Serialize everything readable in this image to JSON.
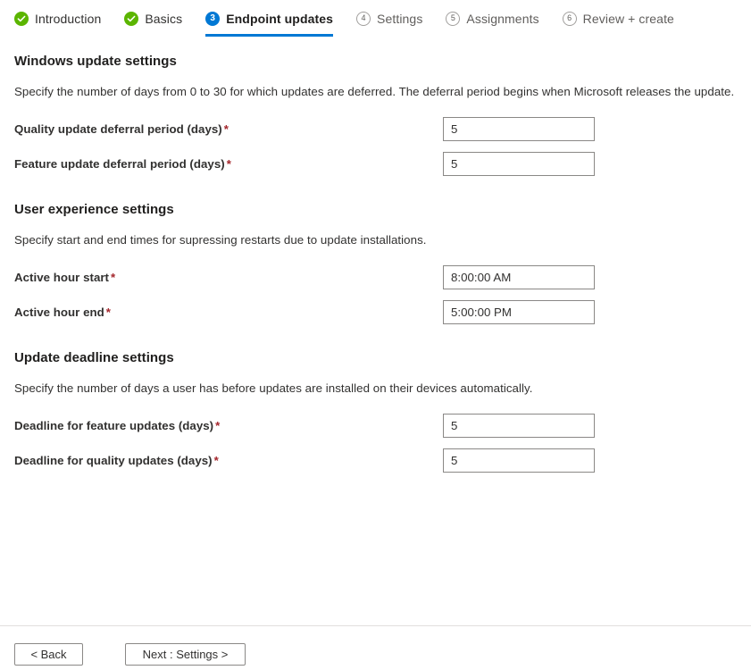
{
  "wizard": {
    "tabs": [
      {
        "label": "Introduction",
        "state": "done",
        "marker": "check-icon"
      },
      {
        "label": "Basics",
        "state": "done",
        "marker": "check-icon"
      },
      {
        "label": "Endpoint updates",
        "state": "current",
        "marker": "3"
      },
      {
        "label": "Settings",
        "state": "pending",
        "marker": "4"
      },
      {
        "label": "Assignments",
        "state": "pending",
        "marker": "5"
      },
      {
        "label": "Review + create",
        "state": "pending",
        "marker": "6"
      }
    ]
  },
  "sections": [
    {
      "title": "Windows update settings",
      "description": "Specify the number of days from 0 to 30 for which updates are deferred. The deferral period begins when Microsoft releases the update.",
      "fields": [
        {
          "label": "Quality update deferral period (days)",
          "required": "*",
          "value": "5",
          "placeholder": ""
        },
        {
          "label": "Feature update deferral period (days)",
          "required": "*",
          "value": "5",
          "placeholder": ""
        }
      ]
    },
    {
      "title": "User experience settings",
      "description": "Specify start and end times for supressing restarts due to update installations.",
      "fields": [
        {
          "label": "Active hour start",
          "required": "*",
          "value": "8:00:00 AM",
          "placeholder": ""
        },
        {
          "label": "Active hour end",
          "required": "*",
          "value": "5:00:00 PM",
          "placeholder": ""
        }
      ]
    },
    {
      "title": "Update deadline settings",
      "description": "Specify the number of days a user has before updates are installed on their devices automatically.",
      "fields": [
        {
          "label": "Deadline for feature updates (days)",
          "required": "*",
          "value": "5",
          "placeholder": ""
        },
        {
          "label": "Deadline for quality updates (days)",
          "required": "*",
          "value": "5",
          "placeholder": ""
        }
      ]
    }
  ],
  "footer": {
    "back_label": "< Back",
    "next_label": "Next : Settings >"
  },
  "colors": {
    "accent": "#0078d4",
    "success": "#5bb500",
    "required": "#a4262c",
    "border": "#8a8886",
    "divider": "#e1dfdd"
  }
}
